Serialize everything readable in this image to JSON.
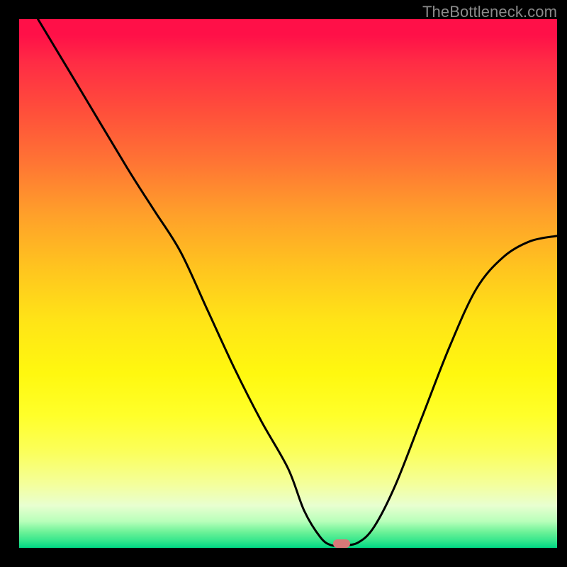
{
  "watermark": "TheBottleneck.com",
  "marker": {
    "x_pct": 60,
    "color": "#d87878"
  },
  "chart_data": {
    "type": "line",
    "title": "",
    "xlabel": "",
    "ylabel": "",
    "xlim": [
      0,
      100
    ],
    "ylim": [
      0,
      100
    ],
    "series": [
      {
        "name": "bottleneck-curve",
        "x": [
          3.5,
          10,
          20,
          25,
          30,
          35,
          40,
          45,
          50,
          53,
          56,
          58,
          60,
          63,
          66,
          70,
          75,
          80,
          85,
          90,
          95,
          100
        ],
        "values": [
          100,
          89,
          72,
          64,
          56,
          45,
          34,
          24,
          15,
          7,
          2,
          0.5,
          0.5,
          1,
          4,
          12,
          25,
          38,
          49,
          55,
          58,
          59
        ]
      }
    ],
    "annotations": []
  }
}
